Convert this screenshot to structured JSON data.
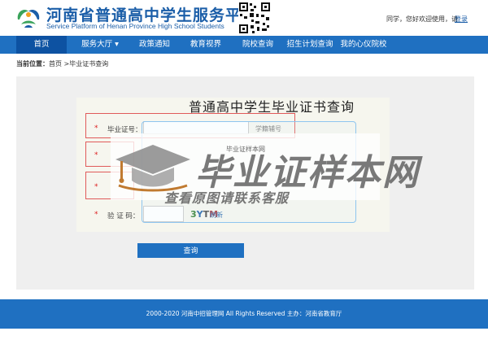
{
  "header": {
    "title": "河南省普通高中学生服务平台",
    "subtitle": "Service Platform of Henan Province High School Students",
    "welcome": "同学，您好欢迎使用，请",
    "login_label": "登录",
    "logo_icon": "leaf-figure-logo-icon",
    "qr_icon": "qr-code-icon"
  },
  "nav": {
    "items": [
      {
        "label": "首页",
        "active": true
      },
      {
        "label": "服务大厅 ▾"
      },
      {
        "label": "政策通知"
      },
      {
        "label": "教育视界"
      },
      {
        "label": "院校查询"
      },
      {
        "label": "招生计划查询"
      },
      {
        "label": "我的心仪院校"
      }
    ]
  },
  "breadcrumb": {
    "label": "当前位置：",
    "path": "首页 >毕业证书查询"
  },
  "form": {
    "title": "普通高中学生毕业证书查询",
    "star": "*",
    "certificate_label": "毕业证号：",
    "student_id_hint": "学籍辅号",
    "captcha_label": "验 证 码：",
    "captcha_value": "",
    "captcha_code": [
      "3",
      "Y",
      "T",
      "M"
    ],
    "captcha_colors": [
      "#2a7a2a",
      "#1b5ea8",
      "#444444",
      "#b03030"
    ],
    "refresh_label": "刷新",
    "submit_label": "查询"
  },
  "watermark": {
    "main": "毕业证样本网",
    "small": "毕业证样本网",
    "sub": "查看原图请联系客服"
  },
  "footer": {
    "text": "2000-2020 河南中招管理网 All Rights Reserved 主办：河南省教育厅"
  },
  "colors": {
    "brand_blue": "#1f70c1",
    "nav_active": "#0d52a2",
    "highlight_red": "#e05a5a"
  }
}
